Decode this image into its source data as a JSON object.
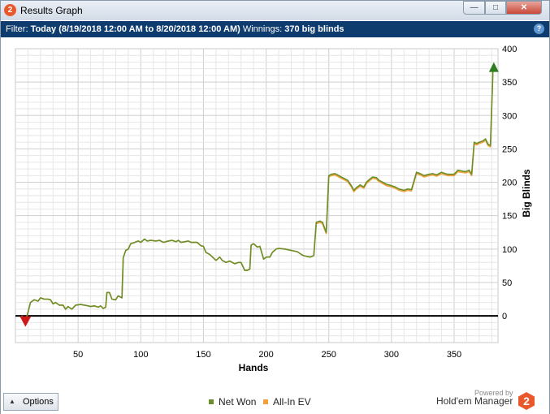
{
  "window": {
    "title": "Results Graph",
    "app_icon_glyph": "2",
    "minimize_glyph": "—",
    "maximize_glyph": "□",
    "close_glyph": "✕"
  },
  "filter": {
    "label": "Filter:",
    "range": "Today (8/19/2018 12:00 AM to 8/20/2018 12:00 AM)",
    "winnings_label": "Winnings:",
    "winnings_value": "370 big blinds",
    "help_glyph": "?"
  },
  "footer": {
    "options_label": "Options",
    "options_arrow": "▲",
    "powered_by": "Powered by",
    "brand": "Hold'em Manager",
    "brand_logo_glyph": "2"
  },
  "colors": {
    "net_won": "#6a8f2a",
    "all_in_ev": "#f2a13a",
    "zero_line": "#000000",
    "start_marker": "#cc1a1a",
    "end_marker": "#2e7d1e",
    "brand_orange": "#e8582b"
  },
  "chart_data": {
    "type": "line",
    "xlabel": "Hands",
    "ylabel": "Big Blinds",
    "xlim": [
      0,
      385
    ],
    "ylim": [
      -40,
      400
    ],
    "x_ticks": [
      50,
      100,
      150,
      200,
      250,
      300,
      350
    ],
    "y_ticks": [
      0,
      50,
      100,
      150,
      200,
      250,
      300,
      350,
      400
    ],
    "y_axis_side": "right",
    "grid": true,
    "legend": "bottom-center",
    "series": [
      {
        "name": "Net Won",
        "color": "#6a8f2a",
        "points": [
          [
            5,
            0
          ],
          [
            8,
            -8
          ],
          [
            10,
            5
          ],
          [
            12,
            20
          ],
          [
            15,
            24
          ],
          [
            18,
            22
          ],
          [
            20,
            27
          ],
          [
            23,
            25
          ],
          [
            26,
            25
          ],
          [
            28,
            24
          ],
          [
            30,
            18
          ],
          [
            32,
            20
          ],
          [
            35,
            16
          ],
          [
            38,
            16
          ],
          [
            40,
            10
          ],
          [
            42,
            14
          ],
          [
            45,
            10
          ],
          [
            48,
            16
          ],
          [
            52,
            17
          ],
          [
            55,
            16
          ],
          [
            58,
            15
          ],
          [
            60,
            14
          ],
          [
            63,
            15
          ],
          [
            66,
            13
          ],
          [
            68,
            15
          ],
          [
            70,
            11
          ],
          [
            72,
            13
          ],
          [
            73,
            35
          ],
          [
            75,
            35
          ],
          [
            77,
            25
          ],
          [
            80,
            24
          ],
          [
            82,
            30
          ],
          [
            85,
            27
          ],
          [
            86,
            87
          ],
          [
            88,
            98
          ],
          [
            90,
            100
          ],
          [
            92,
            108
          ],
          [
            95,
            110
          ],
          [
            98,
            112
          ],
          [
            100,
            110
          ],
          [
            103,
            115
          ],
          [
            105,
            112
          ],
          [
            108,
            113
          ],
          [
            112,
            112
          ],
          [
            115,
            113
          ],
          [
            118,
            110
          ],
          [
            120,
            111
          ],
          [
            122,
            112
          ],
          [
            125,
            113
          ],
          [
            128,
            111
          ],
          [
            130,
            113
          ],
          [
            132,
            110
          ],
          [
            135,
            111
          ],
          [
            138,
            112
          ],
          [
            140,
            110
          ],
          [
            145,
            110
          ],
          [
            148,
            105
          ],
          [
            150,
            104
          ],
          [
            152,
            95
          ],
          [
            155,
            92
          ],
          [
            160,
            83
          ],
          [
            163,
            88
          ],
          [
            165,
            83
          ],
          [
            168,
            80
          ],
          [
            171,
            82
          ],
          [
            175,
            78
          ],
          [
            178,
            80
          ],
          [
            180,
            80
          ],
          [
            183,
            68
          ],
          [
            185,
            68
          ],
          [
            187,
            70
          ],
          [
            188,
            106
          ],
          [
            190,
            108
          ],
          [
            193,
            103
          ],
          [
            195,
            104
          ],
          [
            198,
            85
          ],
          [
            200,
            88
          ],
          [
            203,
            88
          ],
          [
            205,
            95
          ],
          [
            208,
            100
          ],
          [
            210,
            101
          ],
          [
            215,
            100
          ],
          [
            220,
            98
          ],
          [
            225,
            96
          ],
          [
            228,
            92
          ],
          [
            230,
            90
          ],
          [
            235,
            88
          ],
          [
            238,
            90
          ],
          [
            240,
            140
          ],
          [
            243,
            142
          ],
          [
            245,
            140
          ],
          [
            248,
            125
          ],
          [
            250,
            210
          ],
          [
            252,
            212
          ],
          [
            255,
            213
          ],
          [
            258,
            210
          ],
          [
            260,
            208
          ],
          [
            263,
            205
          ],
          [
            265,
            203
          ],
          [
            268,
            195
          ],
          [
            270,
            188
          ],
          [
            272,
            192
          ],
          [
            275,
            196
          ],
          [
            278,
            193
          ],
          [
            280,
            200
          ],
          [
            283,
            205
          ],
          [
            285,
            208
          ],
          [
            288,
            207
          ],
          [
            290,
            203
          ],
          [
            293,
            200
          ],
          [
            296,
            197
          ],
          [
            300,
            195
          ],
          [
            303,
            193
          ],
          [
            306,
            190
          ],
          [
            310,
            188
          ],
          [
            313,
            190
          ],
          [
            316,
            189
          ],
          [
            320,
            215
          ],
          [
            323,
            213
          ],
          [
            326,
            210
          ],
          [
            330,
            212
          ],
          [
            333,
            213
          ],
          [
            336,
            211
          ],
          [
            340,
            215
          ],
          [
            343,
            213
          ],
          [
            345,
            212
          ],
          [
            348,
            212
          ],
          [
            350,
            212
          ],
          [
            353,
            218
          ],
          [
            356,
            217
          ],
          [
            359,
            216
          ],
          [
            362,
            218
          ],
          [
            364,
            212
          ],
          [
            366,
            260
          ],
          [
            368,
            258
          ],
          [
            370,
            260
          ],
          [
            373,
            262
          ],
          [
            375,
            265
          ],
          [
            377,
            257
          ],
          [
            379,
            255
          ],
          [
            381,
            370
          ]
        ]
      },
      {
        "name": "All-In EV",
        "color": "#f2a13a",
        "points": [
          [
            5,
            0
          ],
          [
            8,
            -8
          ],
          [
            10,
            5
          ],
          [
            12,
            20
          ],
          [
            15,
            24
          ],
          [
            18,
            22
          ],
          [
            20,
            27
          ],
          [
            23,
            25
          ],
          [
            26,
            25
          ],
          [
            28,
            24
          ],
          [
            30,
            18
          ],
          [
            32,
            20
          ],
          [
            35,
            16
          ],
          [
            38,
            16
          ],
          [
            40,
            10
          ],
          [
            42,
            14
          ],
          [
            45,
            10
          ],
          [
            48,
            16
          ],
          [
            52,
            17
          ],
          [
            55,
            16
          ],
          [
            58,
            15
          ],
          [
            60,
            14
          ],
          [
            63,
            15
          ],
          [
            66,
            13
          ],
          [
            68,
            15
          ],
          [
            70,
            11
          ],
          [
            72,
            13
          ],
          [
            73,
            35
          ],
          [
            75,
            35
          ],
          [
            77,
            25
          ],
          [
            80,
            24
          ],
          [
            82,
            30
          ],
          [
            85,
            27
          ],
          [
            86,
            87
          ],
          [
            88,
            98
          ],
          [
            90,
            100
          ],
          [
            92,
            108
          ],
          [
            95,
            110
          ],
          [
            98,
            112
          ],
          [
            100,
            110
          ],
          [
            103,
            115
          ],
          [
            105,
            112
          ],
          [
            108,
            113
          ],
          [
            112,
            112
          ],
          [
            115,
            113
          ],
          [
            118,
            110
          ],
          [
            120,
            111
          ],
          [
            122,
            112
          ],
          [
            125,
            113
          ],
          [
            128,
            111
          ],
          [
            130,
            113
          ],
          [
            132,
            110
          ],
          [
            135,
            111
          ],
          [
            138,
            112
          ],
          [
            140,
            110
          ],
          [
            145,
            110
          ],
          [
            148,
            105
          ],
          [
            150,
            104
          ],
          [
            152,
            95
          ],
          [
            155,
            92
          ],
          [
            160,
            83
          ],
          [
            163,
            88
          ],
          [
            165,
            83
          ],
          [
            168,
            80
          ],
          [
            171,
            82
          ],
          [
            175,
            78
          ],
          [
            178,
            80
          ],
          [
            180,
            80
          ],
          [
            183,
            68
          ],
          [
            185,
            68
          ],
          [
            187,
            70
          ],
          [
            188,
            106
          ],
          [
            190,
            108
          ],
          [
            193,
            103
          ],
          [
            195,
            104
          ],
          [
            198,
            85
          ],
          [
            200,
            88
          ],
          [
            203,
            88
          ],
          [
            205,
            95
          ],
          [
            208,
            100
          ],
          [
            210,
            101
          ],
          [
            215,
            100
          ],
          [
            220,
            98
          ],
          [
            225,
            96
          ],
          [
            228,
            92
          ],
          [
            230,
            90
          ],
          [
            235,
            88
          ],
          [
            238,
            90
          ],
          [
            240,
            138
          ],
          [
            243,
            140
          ],
          [
            245,
            138
          ],
          [
            248,
            123
          ],
          [
            250,
            208
          ],
          [
            252,
            210
          ],
          [
            255,
            211
          ],
          [
            258,
            208
          ],
          [
            260,
            206
          ],
          [
            263,
            203
          ],
          [
            265,
            201
          ],
          [
            268,
            193
          ],
          [
            270,
            186
          ],
          [
            272,
            190
          ],
          [
            275,
            194
          ],
          [
            278,
            191
          ],
          [
            280,
            198
          ],
          [
            283,
            203
          ],
          [
            285,
            206
          ],
          [
            288,
            205
          ],
          [
            290,
            201
          ],
          [
            293,
            198
          ],
          [
            296,
            195
          ],
          [
            300,
            193
          ],
          [
            303,
            191
          ],
          [
            306,
            188
          ],
          [
            310,
            186
          ],
          [
            313,
            188
          ],
          [
            316,
            187
          ],
          [
            320,
            213
          ],
          [
            323,
            211
          ],
          [
            326,
            208
          ],
          [
            330,
            210
          ],
          [
            333,
            211
          ],
          [
            336,
            209
          ],
          [
            340,
            213
          ],
          [
            343,
            211
          ],
          [
            345,
            210
          ],
          [
            348,
            210
          ],
          [
            350,
            210
          ],
          [
            353,
            216
          ],
          [
            356,
            215
          ],
          [
            359,
            214
          ],
          [
            362,
            216
          ],
          [
            364,
            210
          ],
          [
            366,
            258
          ],
          [
            368,
            256
          ],
          [
            370,
            258
          ],
          [
            373,
            260
          ],
          [
            375,
            263
          ],
          [
            377,
            255
          ],
          [
            379,
            253
          ],
          [
            381,
            368
          ]
        ]
      }
    ]
  }
}
